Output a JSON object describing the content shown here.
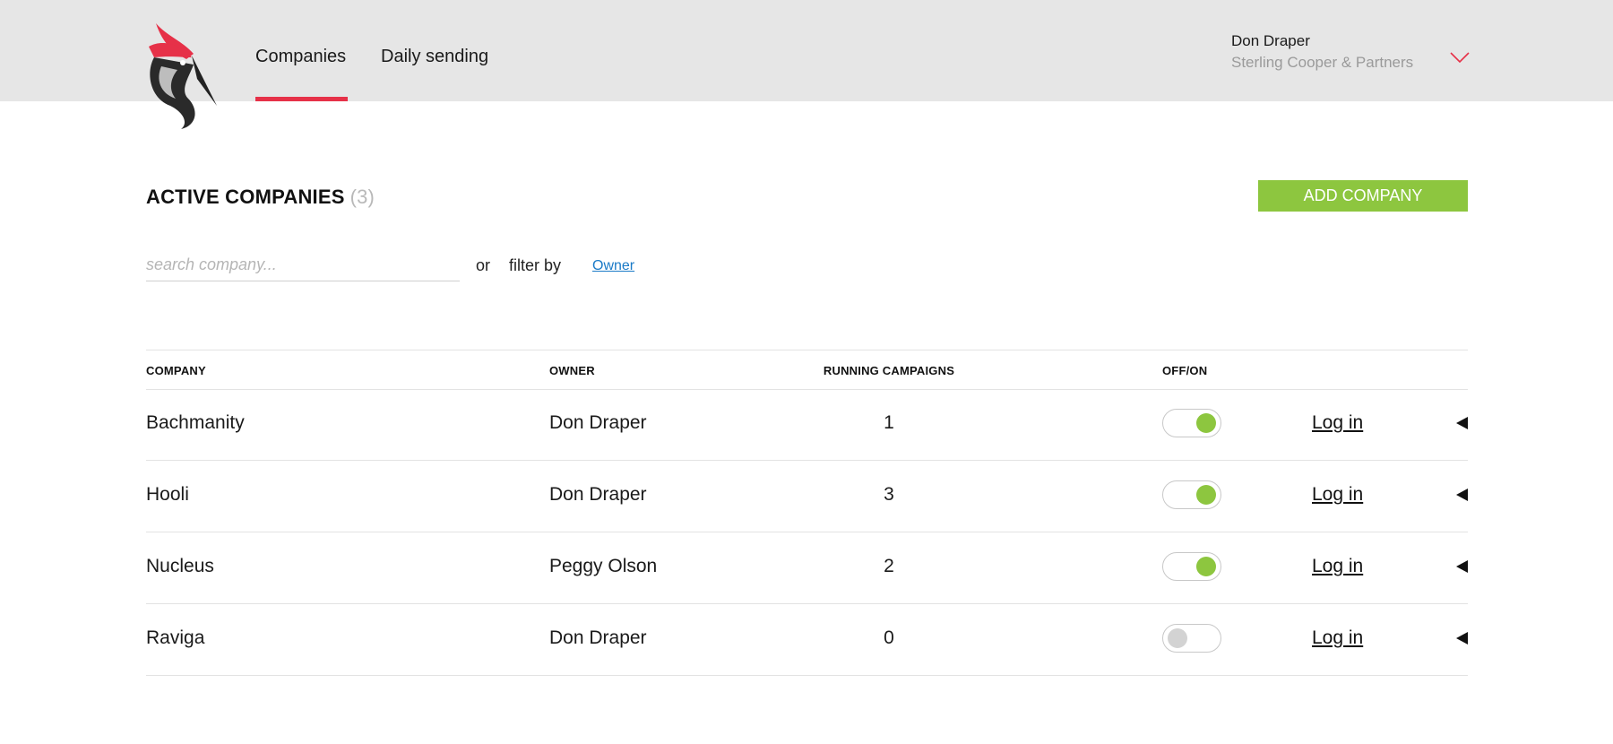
{
  "header": {
    "nav": [
      {
        "label": "Companies",
        "active": true
      },
      {
        "label": "Daily sending",
        "active": false
      }
    ],
    "user": {
      "name": "Don Draper",
      "company": "Sterling Cooper & Partners"
    }
  },
  "main": {
    "title": "ACTIVE COMPANIES",
    "count": "(3)",
    "add_button": "ADD COMPANY",
    "search_placeholder": "search company...",
    "or_label": "or",
    "filter_label": "filter by",
    "filter_link": "Owner"
  },
  "table": {
    "columns": [
      "COMPANY",
      "OWNER",
      "RUNNING CAMPAIGNS",
      "OFF/ON"
    ],
    "rows": [
      {
        "company": "Bachmanity",
        "owner": "Don Draper",
        "running": "1",
        "enabled": true,
        "action": "Log in"
      },
      {
        "company": "Hooli",
        "owner": "Don Draper",
        "running": "3",
        "enabled": true,
        "action": "Log in"
      },
      {
        "company": "Nucleus",
        "owner": "Peggy Olson",
        "running": "2",
        "enabled": true,
        "action": "Log in"
      },
      {
        "company": "Raviga",
        "owner": "Don Draper",
        "running": "0",
        "enabled": false,
        "action": "Log in"
      }
    ]
  },
  "colors": {
    "accent_red": "#e63148",
    "accent_green": "#8dc63f",
    "link_blue": "#1a7ac7",
    "header_bg": "#e6e6e6"
  },
  "icons": {
    "logo": "woodpecker-logo-icon",
    "user_menu": "chevron-down-icon",
    "row_expand": "caret-left-icon"
  }
}
